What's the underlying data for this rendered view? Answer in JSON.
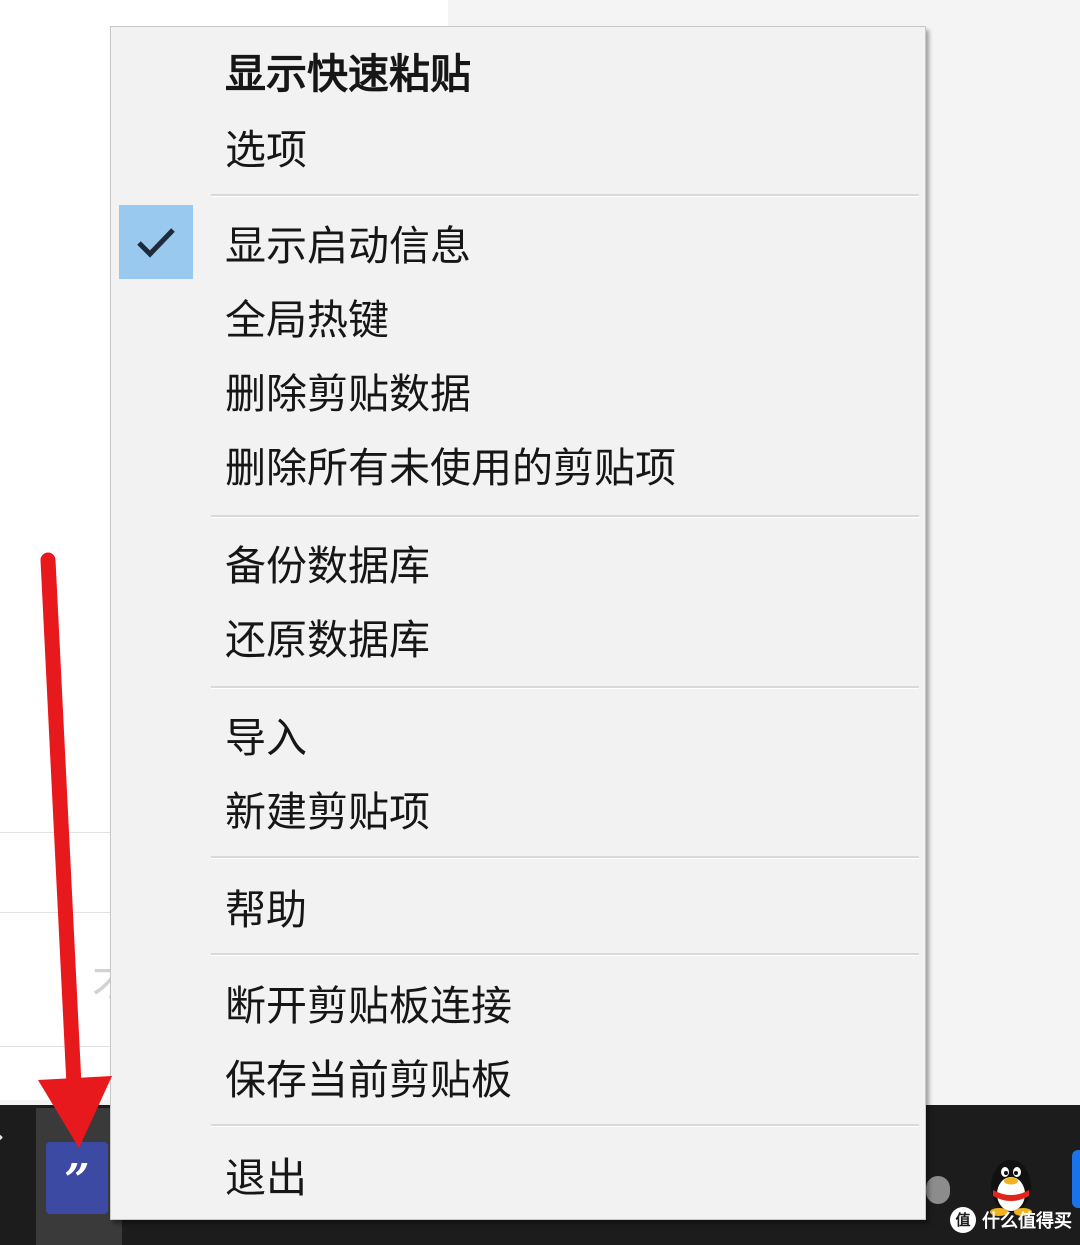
{
  "menu": {
    "items": [
      {
        "label": "显示快速粘贴",
        "bold": true
      },
      {
        "label": "选项"
      },
      {
        "label": "显示启动信息",
        "checked": true
      },
      {
        "label": "全局热键"
      },
      {
        "label": "删除剪贴数据"
      },
      {
        "label": "删除所有未使用的剪贴项"
      },
      {
        "label": "备份数据库"
      },
      {
        "label": "还原数据库"
      },
      {
        "label": "导入"
      },
      {
        "label": "新建剪贴项"
      },
      {
        "label": "帮助"
      },
      {
        "label": "断开剪贴板连接"
      },
      {
        "label": "保存当前剪贴板"
      },
      {
        "label": "退出"
      }
    ]
  },
  "taskbar": {
    "app_icon_glyph": "”",
    "chevron_glyph": "›",
    "app_icon_color": "#3c4aa4"
  },
  "background": {
    "partial_char": "才"
  },
  "watermark": {
    "text": "什么值得买",
    "icon_glyph": "值"
  },
  "colors": {
    "check_highlight": "#99c9ef",
    "annotation_arrow": "#e8191d",
    "menu_background": "#f2f2f2"
  }
}
